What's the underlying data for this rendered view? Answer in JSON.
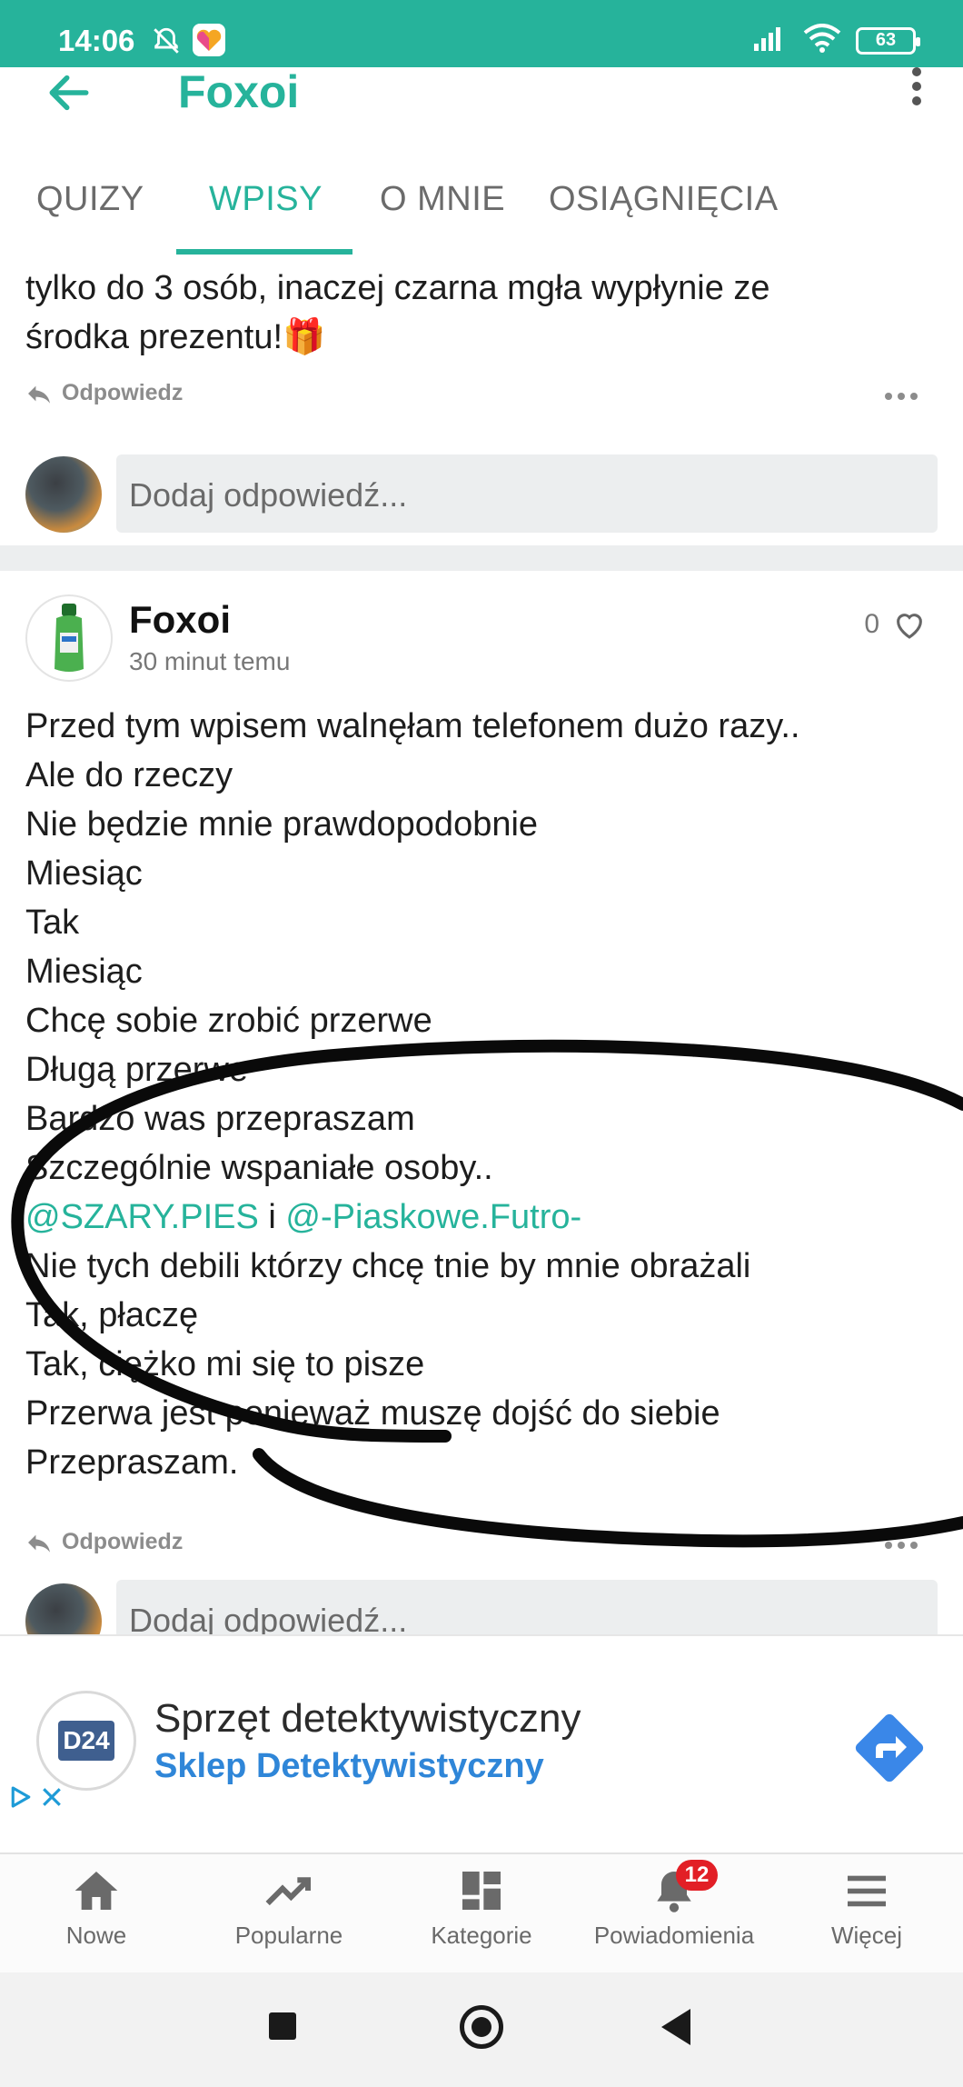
{
  "status_bar": {
    "time": "14:06",
    "battery": "63"
  },
  "app_bar": {
    "title": "Foxoi"
  },
  "tabs": [
    {
      "label": "QUIZY"
    },
    {
      "label": "WPISY"
    },
    {
      "label": "O MNIE"
    },
    {
      "label": "OSIĄGNIĘCIA"
    }
  ],
  "previous_comment": {
    "lines": [
      "tylko do 3 osób, inaczej czarna mgła wypłynie ze",
      "środka prezentu!🎁"
    ],
    "reply_label": "Odpowiedz",
    "reply_placeholder": "Dodaj odpowiedź..."
  },
  "post": {
    "author": "Foxoi",
    "time": "30 minut temu",
    "likes": "0",
    "lines_before_mentions": [
      "Przed tym wpisem walnęłam telefonem dużo razy..",
      "Ale do rzeczy",
      "Nie będzie mnie prawdopodobnie",
      "Miesiąc",
      "Tak",
      "Miesiąc",
      "Chcę sobie zrobić przerwe",
      "Długą przerwe",
      "Bardzo was przepraszam",
      "Szczególnie wspaniałe osoby.."
    ],
    "mention_1": "@SZARY.PIES",
    "mention_joiner": " i ",
    "mention_2": "@-Piaskowe.Futro-",
    "lines_after_mentions": [
      "Nie tych debili którzy chcę tnie by mnie obrażali",
      "Tak, płaczę",
      "Tak, ciężko mi się to pisze",
      "Przerwa jest ponieważ muszę dojść do siebie",
      "Przepraszam."
    ],
    "reply_label": "Odpowiedz",
    "reply_placeholder": "Dodaj odpowiedź..."
  },
  "ad": {
    "title": "Sprzęt detektywistyczny",
    "subtitle": "Sklep Detektywistyczny",
    "logo_text": "D24"
  },
  "bottom_nav": [
    {
      "label": "Nowe",
      "icon": "home-icon"
    },
    {
      "label": "Popularne",
      "icon": "trending-icon"
    },
    {
      "label": "Kategorie",
      "icon": "categories-icon"
    },
    {
      "label": "Powiadomienia",
      "icon": "bell-icon",
      "badge": "12"
    },
    {
      "label": "Więcej",
      "icon": "menu-icon"
    }
  ],
  "colors": {
    "accent": "#26b39b",
    "link": "#2f86d8",
    "badge": "#e21f26"
  }
}
